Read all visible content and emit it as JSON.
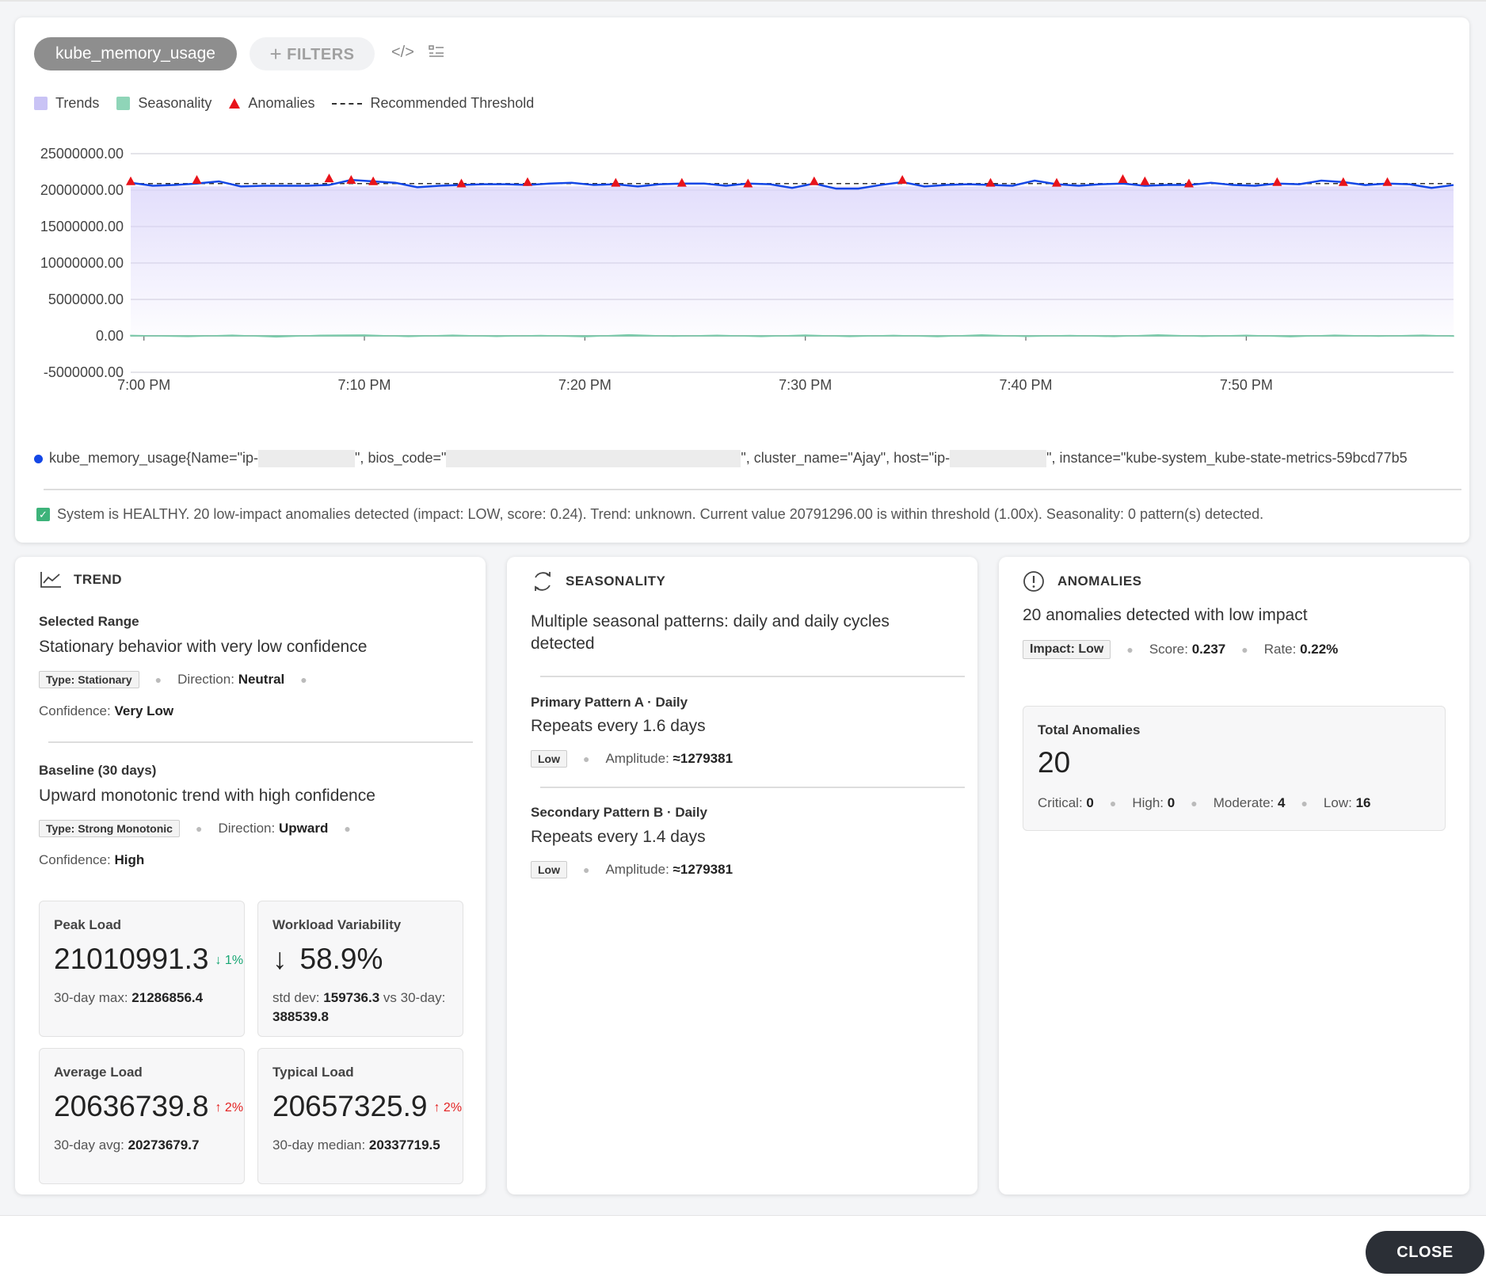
{
  "toolbar": {
    "metric_pill": "kube_memory_usage",
    "filters_label": "FILTERS",
    "filters_plus": "+",
    "code_icon": "</>",
    "code_icon_name": "code-icon",
    "list_icon_name": "list-settings-icon"
  },
  "legend": {
    "trends": "Trends",
    "seasonality": "Seasonality",
    "anomalies": "Anomalies",
    "threshold": "Recommended Threshold"
  },
  "colors": {
    "trend_fill": "#c9c3f5",
    "seasonality_fill": "#8fd5b8",
    "series_line": "#1447e6",
    "anomaly": "#e8131a",
    "threshold": "#333333"
  },
  "chart_data": {
    "type": "line",
    "ylim": [
      -5000000,
      25000000
    ],
    "y_ticks": [
      "25000000.00",
      "20000000.00",
      "15000000.00",
      "10000000.00",
      "5000000.00",
      "0.00",
      "-5000000.00"
    ],
    "x_ticks": [
      "7:00 PM",
      "7:10 PM",
      "7:20 PM",
      "7:30 PM",
      "7:40 PM",
      "7:50 PM"
    ],
    "x_tick_minutes": [
      0,
      10,
      20,
      30,
      40,
      50
    ],
    "x_range_minutes": [
      -0.6,
      59.4
    ],
    "threshold": 20900000,
    "trend_fill_level": 20500000,
    "series": [
      {
        "name": "kube_memory_usage",
        "x": [
          -0.6,
          0.4,
          1.4,
          2.4,
          3.4,
          4.4,
          5.4,
          6.4,
          7.4,
          8.4,
          9.4,
          10.4,
          11.4,
          12.4,
          13.4,
          14.4,
          15.4,
          16.4,
          17.4,
          18.4,
          19.4,
          20.4,
          21.4,
          22.4,
          23.4,
          24.4,
          25.4,
          26.4,
          27.4,
          28.4,
          29.4,
          30.4,
          31.4,
          32.4,
          33.4,
          34.4,
          35.4,
          36.4,
          37.4,
          38.4,
          39.4,
          40.4,
          41.4,
          42.4,
          43.4,
          44.4,
          45.4,
          46.4,
          47.4,
          48.4,
          49.4,
          50.4,
          51.4,
          52.4,
          53.4,
          54.4,
          55.4,
          56.4,
          57.4,
          58.4,
          59.4
        ],
        "y": [
          21000000,
          20600000,
          20700000,
          20900000,
          21200000,
          20500000,
          20600000,
          20600000,
          20600000,
          20700000,
          21400000,
          21200000,
          21000000,
          20400000,
          20600000,
          20700000,
          20800000,
          20800000,
          20700000,
          20900000,
          21000000,
          20700000,
          20800000,
          20500000,
          20800000,
          20900000,
          20900000,
          20600000,
          20900000,
          20800000,
          20300000,
          20900000,
          20200000,
          20200000,
          20700000,
          21100000,
          20500000,
          20700000,
          20800000,
          20700000,
          20600000,
          21300000,
          20800000,
          20600000,
          20800000,
          20900000,
          20600000,
          20700000,
          20700000,
          21000000,
          20700000,
          20600000,
          20900000,
          20800000,
          21300000,
          21100000,
          20700000,
          20900000,
          20800000,
          20300000,
          20700000
        ]
      }
    ],
    "seasonality_series": {
      "x": [
        -0.6,
        2,
        4,
        6,
        8,
        10,
        12,
        14,
        16,
        18,
        20,
        22,
        24,
        26,
        28,
        30,
        32,
        34,
        36,
        38,
        40,
        42,
        44,
        46,
        48,
        50,
        52,
        54,
        56,
        58,
        59.4
      ],
      "y": [
        60000,
        -100000,
        100000,
        -150000,
        80000,
        120000,
        -100000,
        90000,
        -80000,
        60000,
        -120000,
        150000,
        -60000,
        80000,
        -100000,
        110000,
        -90000,
        70000,
        -110000,
        130000,
        -80000,
        60000,
        -100000,
        140000,
        -70000,
        80000,
        -120000,
        90000,
        -60000,
        100000,
        -50000
      ]
    },
    "anomaly_points": [
      {
        "x": -0.6,
        "y": 21000000
      },
      {
        "x": 2.4,
        "y": 21200000
      },
      {
        "x": 8.4,
        "y": 21400000
      },
      {
        "x": 9.4,
        "y": 21200000
      },
      {
        "x": 10.4,
        "y": 21000000
      },
      {
        "x": 14.4,
        "y": 20700000
      },
      {
        "x": 17.4,
        "y": 20900000
      },
      {
        "x": 21.4,
        "y": 20800000
      },
      {
        "x": 24.4,
        "y": 20800000
      },
      {
        "x": 27.4,
        "y": 20700000
      },
      {
        "x": 30.4,
        "y": 21000000
      },
      {
        "x": 34.4,
        "y": 21200000
      },
      {
        "x": 38.4,
        "y": 20800000
      },
      {
        "x": 41.4,
        "y": 20800000
      },
      {
        "x": 44.4,
        "y": 21300000
      },
      {
        "x": 45.4,
        "y": 21000000
      },
      {
        "x": 47.4,
        "y": 20700000
      },
      {
        "x": 51.4,
        "y": 20900000
      },
      {
        "x": 54.4,
        "y": 20900000
      },
      {
        "x": 56.4,
        "y": 20900000
      }
    ]
  },
  "series_label": {
    "p1": "kube_memory_usage{Name=\"ip-",
    "p2": "\", bios_code=\"",
    "p3": "\", cluster_name=\"Ajay\", host=\"ip-",
    "p4": "\", instance=\"kube-system_kube-state-metrics-59bcd77b5"
  },
  "status_message": "System is HEALTHY. 20 low-impact anomalies detected (impact: LOW, score: 0.24). Trend: unknown. Current value 20791296.00 is within threshold (1.00x). Seasonality: 0 pattern(s) detected.",
  "trend": {
    "title": "TREND",
    "selected": {
      "title": "Selected Range",
      "desc": "Stationary behavior with very low confidence",
      "type_key": "Type:",
      "type_val": "Stationary",
      "direction_key": "Direction:",
      "direction_val": "Neutral",
      "confidence_key": "Confidence:",
      "confidence_val": "Very Low"
    },
    "baseline": {
      "title": "Baseline (30 days)",
      "desc": "Upward monotonic trend with high confidence",
      "type_key": "Type:",
      "type_val": "Strong Monotonic",
      "direction_key": "Direction:",
      "direction_val": "Upward",
      "confidence_key": "Confidence:",
      "confidence_val": "High"
    },
    "stats": {
      "peak": {
        "title": "Peak Load",
        "value": "21010991.3",
        "change": "↓ 1%",
        "sub_key": "30-day max:",
        "sub_val": "21286856.4"
      },
      "variability": {
        "title": "Workload Variability",
        "arrow": "↓",
        "value": "58.9%",
        "sub_key": "std dev:",
        "sub_val": "159736.3",
        "sub_mid": " vs 30-day:",
        "sub_val2": "388539.8"
      },
      "average": {
        "title": "Average Load",
        "value": "20636739.8",
        "change": "↑ 2%",
        "sub_key": "30-day avg:",
        "sub_val": "20273679.7"
      },
      "typical": {
        "title": "Typical Load",
        "value": "20657325.9",
        "change": "↑ 2%",
        "sub_key": "30-day median:",
        "sub_val": "20337719.5"
      }
    }
  },
  "seasonality": {
    "title": "SEASONALITY",
    "desc": "Multiple seasonal patterns: daily and daily cycles detected",
    "primary": {
      "title": "Primary Pattern A · Daily",
      "desc": "Repeats every 1.6 days",
      "badge": "Low",
      "amp_key": "Amplitude:",
      "amp_val": "≈1279381"
    },
    "secondary": {
      "title": "Secondary Pattern B · Daily",
      "desc": "Repeats every 1.4 days",
      "badge": "Low",
      "amp_key": "Amplitude:",
      "amp_val": "≈1279381"
    }
  },
  "anomalies": {
    "title": "ANOMALIES",
    "desc": "20 anomalies detected with low impact",
    "impact_key": "Impact:",
    "impact_val": "Low",
    "score_key": "Score:",
    "score_val": "0.237",
    "rate_key": "Rate:",
    "rate_val": "0.22%",
    "total": {
      "title": "Total Anomalies",
      "value": "20",
      "critical_key": "Critical:",
      "critical_val": "0",
      "high_key": "High:",
      "high_val": "0",
      "moderate_key": "Moderate:",
      "moderate_val": "4",
      "low_key": "Low:",
      "low_val": "16"
    }
  },
  "footer": {
    "close_label": "CLOSE"
  }
}
